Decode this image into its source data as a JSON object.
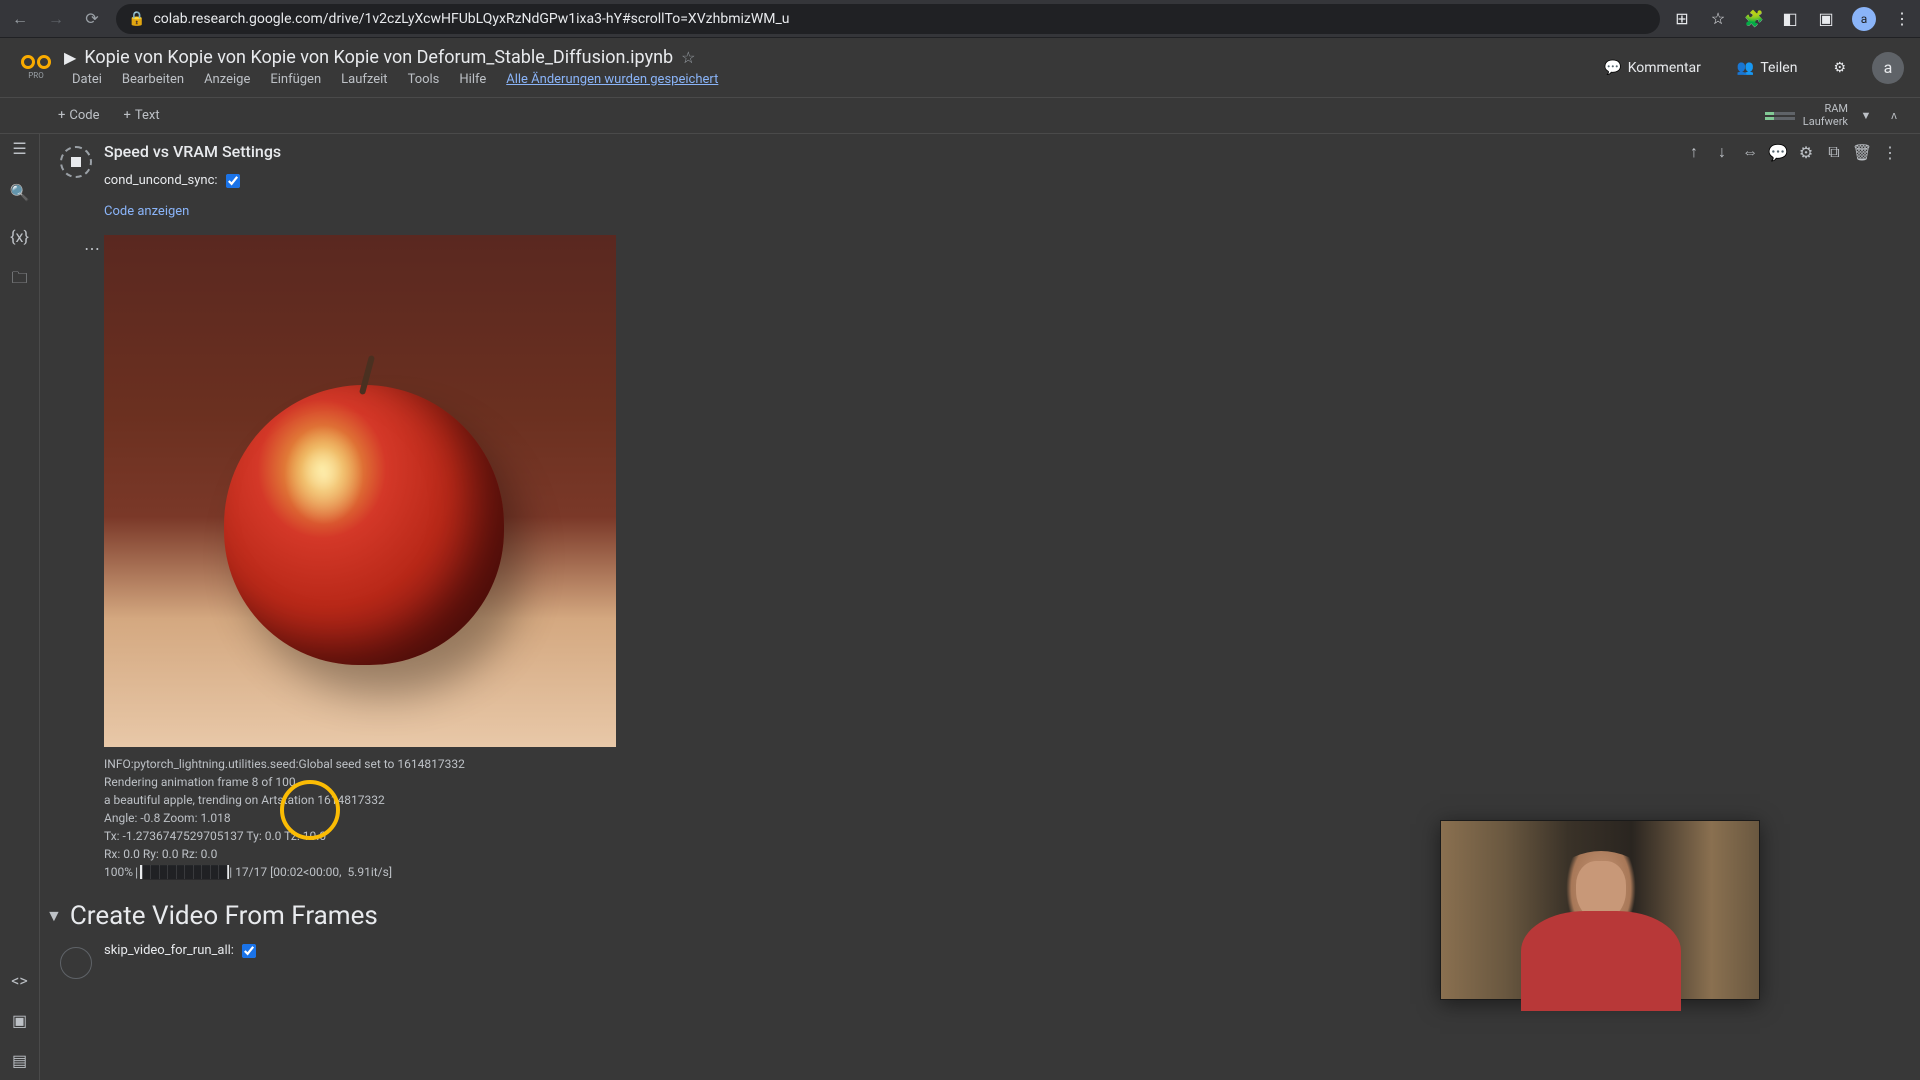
{
  "browser": {
    "url": "colab.research.google.com/drive/1v2czLyXcwHFUbLQyxRzNdGPw1ixa3-hY#scrollTo=XVzhbmizWM_u",
    "avatar_letter": "a"
  },
  "header": {
    "notebook_title": "Kopie von Kopie von Kopie von Kopie von Deforum_Stable_Diffusion.ipynb",
    "pro_label": "PRO",
    "menu": {
      "file": "Datei",
      "edit": "Bearbeiten",
      "view": "Anzeige",
      "insert": "Einfügen",
      "runtime": "Laufzeit",
      "tools": "Tools",
      "help": "Hilfe"
    },
    "saved_message": "Alle Änderungen wurden gespeichert",
    "comment_label": "Kommentar",
    "share_label": "Teilen",
    "header_avatar_letter": "a"
  },
  "toolbar": {
    "code_label": "Code",
    "text_label": "Text",
    "ram_label": "RAM",
    "disk_label": "Laufwerk"
  },
  "cell1": {
    "title": "Speed vs VRAM Settings",
    "param_label": "cond_uncond_sync:",
    "code_link": "Code anzeigen"
  },
  "output": {
    "line1": "INFO:pytorch_lightning.utilities.seed:Global seed set to 1614817332",
    "line2": "Rendering animation frame 8 of 100",
    "line3": "a beautiful apple, trending on Artstation 1614817332",
    "line4": "Angle: -0.8 Zoom: 1.018",
    "line5": "Tx: -1.2736747529705137 Ty: 0.0 Tz: 10.0",
    "line6": "Rx: 0.0 Ry: 0.0 Rz: 0.0",
    "progress_pct": "100%",
    "progress_bar": "██████████",
    "progress_text": "| 17/17 [00:02<00:00,  5.91it/s]"
  },
  "section": {
    "title": "Create Video From Frames"
  },
  "cell2": {
    "param_label": "skip_video_for_run_all:"
  }
}
